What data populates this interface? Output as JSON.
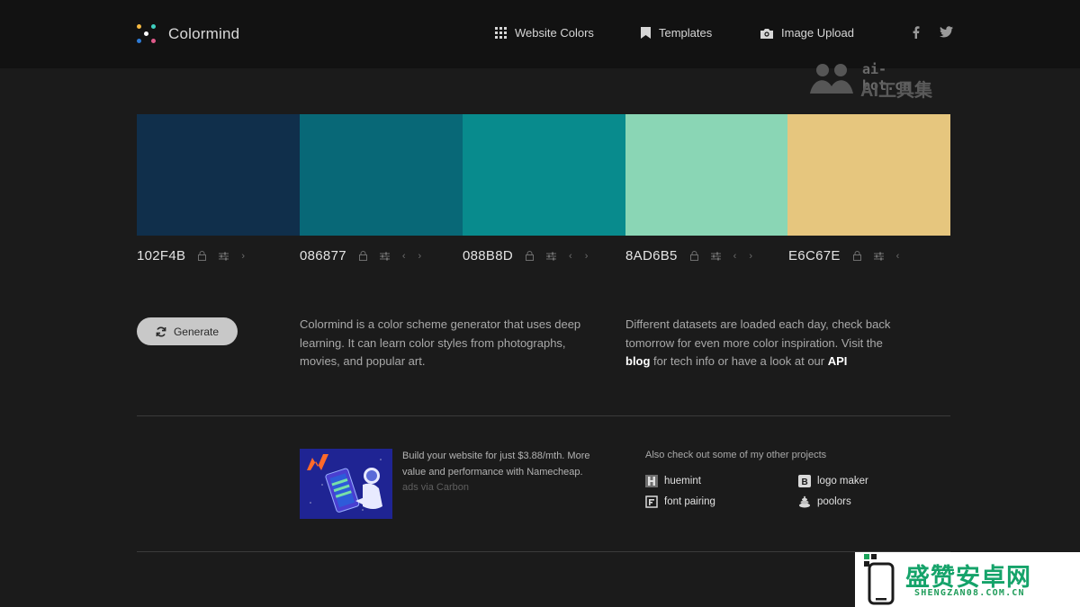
{
  "header": {
    "app_name": "Colormind",
    "nav": [
      {
        "label": "Website Colors",
        "icon": "grid-icon"
      },
      {
        "label": "Templates",
        "icon": "bookmark-icon"
      },
      {
        "label": "Image Upload",
        "icon": "camera-icon"
      }
    ],
    "social": [
      {
        "label": "f",
        "icon": "facebook-icon"
      },
      {
        "label": "twitter",
        "icon": "twitter-icon"
      }
    ]
  },
  "watermark": {
    "domain": "ai-bot.cn",
    "name": "AI工具集"
  },
  "palette": [
    {
      "hex": "102F4B",
      "color": "#102F4B"
    },
    {
      "hex": "086877",
      "color": "#086877"
    },
    {
      "hex": "088B8D",
      "color": "#088B8D"
    },
    {
      "hex": "8AD6B5",
      "color": "#8AD6B5"
    },
    {
      "hex": "E6C67E",
      "color": "#E6C67E"
    }
  ],
  "generate": {
    "label": "Generate"
  },
  "description": {
    "left": "Colormind is a color scheme generator that uses deep learning. It can learn color styles from photographs, movies, and popular art.",
    "right_before": "Different datasets are loaded each day, check back tomorrow for even more color inspiration. Visit the ",
    "right_link_blog": "blog",
    "right_middle": " for tech info or have a look at our ",
    "right_link_api": "API"
  },
  "ad": {
    "text": "Build your website for just $3.88/mth. More value and performance with Namecheap.",
    "via": "ads via Carbon"
  },
  "projects": {
    "title": "Also check out some of my other projects",
    "items": [
      {
        "label": "huemint",
        "icon": "huemint-icon"
      },
      {
        "label": "logo maker",
        "icon": "logo-maker-icon"
      },
      {
        "label": "font pairing",
        "icon": "font-pairing-icon"
      },
      {
        "label": "poolors",
        "icon": "poolors-icon"
      }
    ]
  },
  "bottom_watermark": {
    "name": "盛赞安卓网",
    "url": "SHENGZAN08.COM.CN"
  }
}
